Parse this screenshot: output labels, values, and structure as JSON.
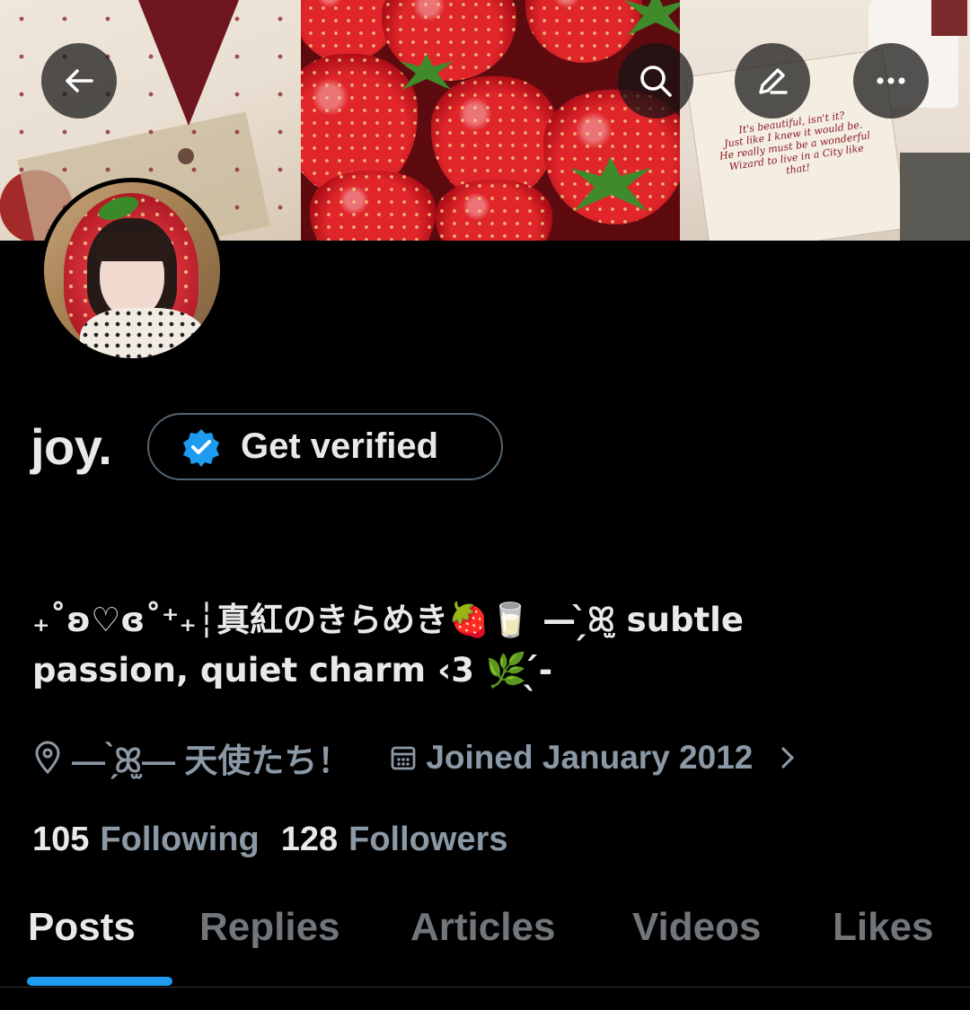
{
  "banner": {
    "quote": "It's beautiful, isn't it?\nJust like I knew it would be.\nHe really must be a wonderful\nWizard to live in a City like that!"
  },
  "header_actions": {
    "back_icon": "back-arrow-icon",
    "search_icon": "search-icon",
    "edit_icon": "edit-pencil-icon",
    "more_icon": "more-horizontal-icon"
  },
  "profile": {
    "name": "joy.",
    "verify_label": "Get verified",
    "verify_color": "#1d9bf0",
    "bio_line1": "₊˚ʚ♡ɞ˚⁺₊┆真紅のきらめき🍓🥛 — ̗̀ꕤ̫ subtle",
    "bio_line2": "passion,  quiet  charm ‹3 🌿 ̖́-",
    "location": "— ̗̀ꕤ̫— 天使たち！",
    "joined": "Joined January 2012",
    "following_count": "105",
    "following_label": "Following",
    "followers_count": "128",
    "followers_label": "Followers"
  },
  "tabs": [
    {
      "label": "Posts",
      "active": true
    },
    {
      "label": "Replies",
      "active": false
    },
    {
      "label": "Articles",
      "active": false
    },
    {
      "label": "Videos",
      "active": false
    },
    {
      "label": "Likes",
      "active": false
    }
  ],
  "colors": {
    "accent": "#1d9bf0",
    "muted": "#8b98a5",
    "text": "#e7e9ea",
    "background": "#000000"
  }
}
